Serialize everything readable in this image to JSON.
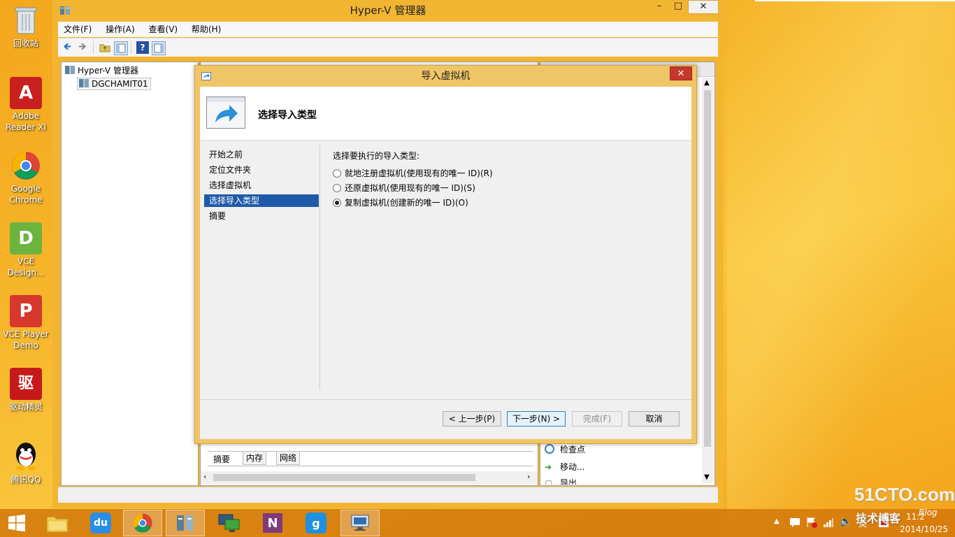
{
  "desktop": {
    "icons": [
      {
        "label": "回收站",
        "icon": "recycle-bin-icon"
      },
      {
        "label": "Adobe Reader XI",
        "icon": "adobe-reader-icon"
      },
      {
        "label": "Google Chrome",
        "icon": "chrome-icon"
      },
      {
        "label": "VCE Design...",
        "icon": "vce-designer-icon"
      },
      {
        "label": "VCE Player Demo",
        "icon": "vce-player-icon"
      },
      {
        "label": "驱动精灵",
        "icon": "driver-genius-icon"
      },
      {
        "label": "腾讯QQ",
        "icon": "qq-icon"
      }
    ]
  },
  "main_window": {
    "title": "Hyper-V 管理器",
    "menu": [
      "文件(F)",
      "操作(A)",
      "查看(V)",
      "帮助(H)"
    ],
    "tree": {
      "root": "Hyper-V 管理器",
      "child": "DGCHAMIT01"
    },
    "bottom_tabs": [
      "摘要",
      "内存",
      "网络"
    ],
    "actions": [
      "检查点",
      "移动...",
      "导出..."
    ]
  },
  "dialog": {
    "title": "导入虚拟机",
    "heading": "选择导入类型",
    "steps": [
      "开始之前",
      "定位文件夹",
      "选择虚拟机",
      "选择导入类型",
      "摘要"
    ],
    "selected_step": 3,
    "prompt": "选择要执行的导入类型:",
    "options": [
      {
        "label": "就地注册虚拟机(使用现有的唯一 ID)(R)",
        "checked": false
      },
      {
        "label": "还原虚拟机(使用现有的唯一 ID)(S)",
        "checked": false
      },
      {
        "label": "复制虚拟机(创建新的唯一 ID)(O)",
        "checked": true
      }
    ],
    "buttons": {
      "prev": "< 上一步(P)",
      "next": "下一步(N) >",
      "finish": "完成(F)",
      "cancel": "取消"
    }
  },
  "taskbar": {
    "clock_time": "11:2",
    "clock_date": "2014/10/25"
  },
  "watermark": {
    "line1": "51CTO.com",
    "line2": "技术博客",
    "line3": "Blog"
  }
}
